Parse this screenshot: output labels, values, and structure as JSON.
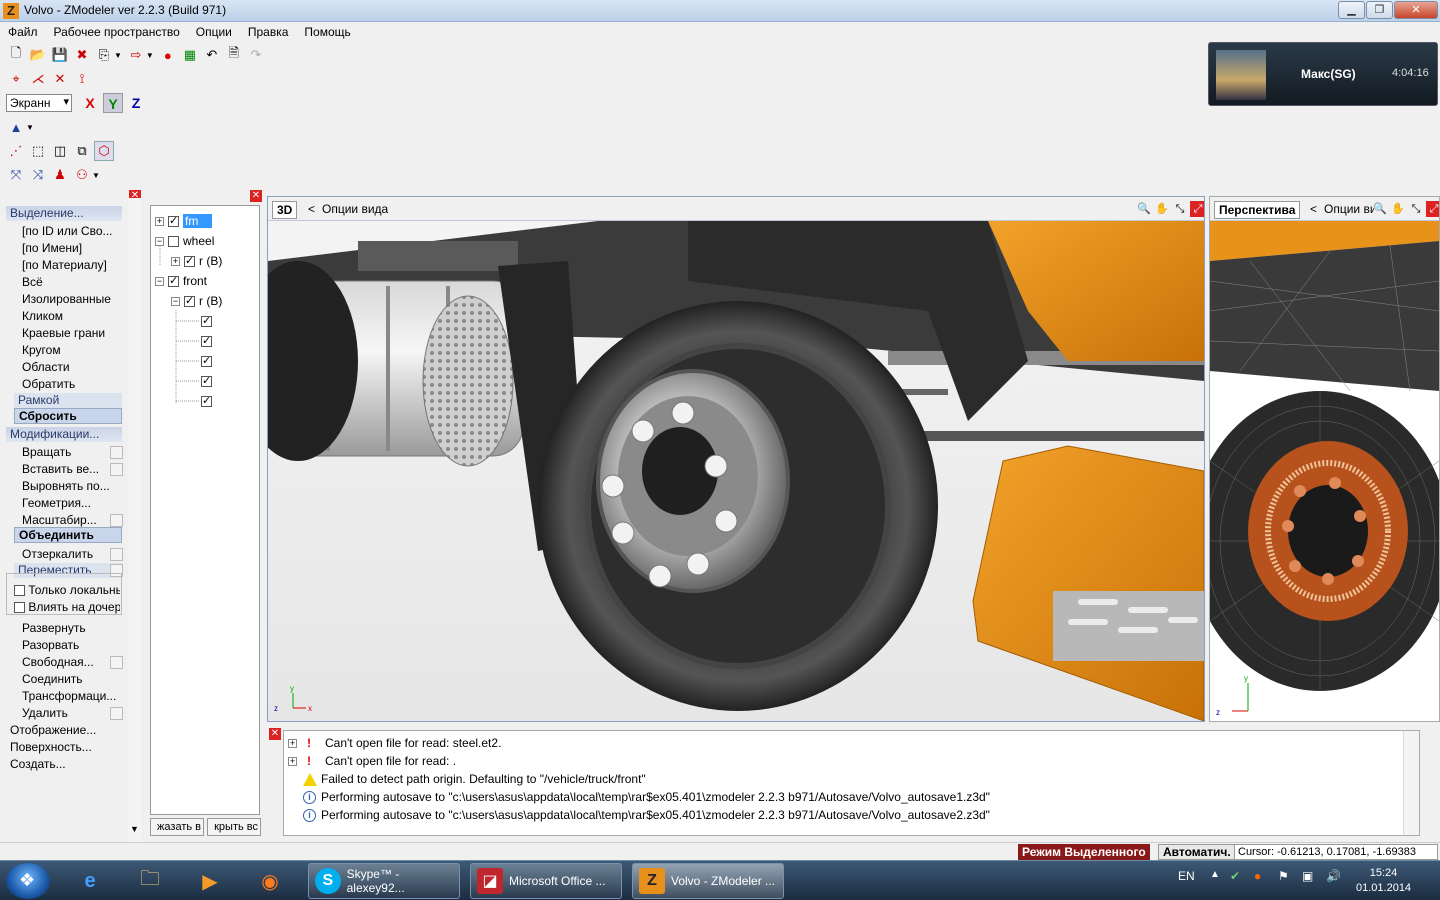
{
  "window": {
    "title": "Volvo - ZModeler ver 2.2.3 (Build 971)",
    "app_icon": "Z",
    "buttons": {
      "minimize": "▁",
      "maximize": "❐",
      "close": "✕"
    }
  },
  "menu": [
    "Файл",
    "Рабочее пространство",
    "Опции",
    "Правка",
    "Помощь"
  ],
  "toolbar": {
    "view_combo": "Экранн",
    "axes": [
      "X",
      "Y",
      "Z"
    ],
    "active_axis": "Y"
  },
  "skype_popup": {
    "name": "Макс(SG)",
    "time": "4:04:16"
  },
  "left_panel": {
    "selection_header": "Выделение...",
    "selection_items": [
      "[по ID или Сво...",
      "[по Имени]",
      "[по Материалу]",
      "Всё",
      "Изолированные",
      "Кликом",
      "Краевые грани",
      "Кругом",
      "Области",
      "Обратить"
    ],
    "frame_mode": "Рамкой",
    "reset_button": "Сбросить",
    "modify_header": "Модификации...",
    "modify_items": [
      "Вращать",
      "Вставить ве...",
      "Выровнять по...",
      "Геометрия...",
      "Масштабир..."
    ],
    "merge_button": "Объединить",
    "mirror_item": "Отзеркалить",
    "move_mode": "Переместить",
    "options": [
      {
        "label": "Только локальны",
        "checked": false
      },
      {
        "label": "Влиять на дочерн",
        "checked": false
      }
    ],
    "more_items": [
      "Развернуть",
      "Разорвать",
      "Свободная...",
      "Соединить",
      "Трансформаци...",
      "Удалить"
    ],
    "bottom_items": [
      "Отображение...",
      "Поверхность...",
      "Создать..."
    ]
  },
  "tree": {
    "nodes": [
      {
        "label": "fm",
        "checked": true,
        "expander": "+",
        "level": 0,
        "selected": true
      },
      {
        "label": "wheel",
        "checked": false,
        "expander": "−",
        "level": 0,
        "selected": false
      },
      {
        "label": "r (B)",
        "checked": true,
        "expander": "+",
        "level": 1,
        "selected": false
      },
      {
        "label": "front",
        "checked": true,
        "expander": "−",
        "level": 0,
        "selected": false
      },
      {
        "label": "r (B)",
        "checked": true,
        "expander": "−",
        "level": 1,
        "selected": false
      },
      {
        "label": "",
        "checked": true,
        "expander": "",
        "level": 2,
        "selected": false
      },
      {
        "label": "",
        "checked": true,
        "expander": "",
        "level": 2,
        "selected": false
      },
      {
        "label": "",
        "checked": true,
        "expander": "",
        "level": 2,
        "selected": false
      },
      {
        "label": "",
        "checked": true,
        "expander": "",
        "level": 2,
        "selected": false
      },
      {
        "label": "",
        "checked": true,
        "expander": "",
        "level": 2,
        "selected": false
      }
    ],
    "show_all_button": "жазать в",
    "hide_all_button": "крыть вс"
  },
  "viewport_main": {
    "tab": "3D",
    "options_label": "Опции вида",
    "arrow": "<"
  },
  "viewport_side": {
    "tab": "Перспектива",
    "options_label": "Опции вида",
    "arrow": "<"
  },
  "log": {
    "entries": [
      {
        "type": "error",
        "expander": "+",
        "text": "Can't open file for read: steel.et2."
      },
      {
        "type": "error",
        "expander": "+",
        "text": "Can't open file for read: ."
      },
      {
        "type": "warning",
        "expander": "",
        "text": "Failed to detect path origin. Defaulting to \"/vehicle/truck/front\""
      },
      {
        "type": "info",
        "expander": "",
        "text": "Performing autosave to \"c:\\users\\asus\\appdata\\local\\temp\\rar$ex05.401\\zmodeler 2.2.3 b971/Autosave/Volvo_autosave1.z3d\""
      },
      {
        "type": "info",
        "expander": "",
        "text": "Performing autosave to \"c:\\users\\asus\\appdata\\local\\temp\\rar$ex05.401\\zmodeler 2.2.3 b971/Autosave/Volvo_autosave2.z3d\""
      }
    ]
  },
  "status": {
    "mode": "Режим Выделенного",
    "auto": "Автоматич.",
    "cursor": "Cursor: -0.61213, 0.17081, -1.69383"
  },
  "taskbar": {
    "tasks": [
      {
        "label": "Skype™ - alexey92...",
        "icon": "S",
        "color": "#00aff0",
        "active": false
      },
      {
        "label": "Microsoft Office ...",
        "icon": "◪",
        "color": "#c0262d",
        "active": false
      },
      {
        "label": "Volvo - ZModeler ...",
        "icon": "Z",
        "color": "#e8901c",
        "active": true
      }
    ],
    "lang": "EN",
    "time": "15:24",
    "date": "01.01.2014"
  },
  "colors": {
    "accent": "#3399ff",
    "cab_orange": "#e8921a",
    "status_red": "#8a1a1a"
  }
}
